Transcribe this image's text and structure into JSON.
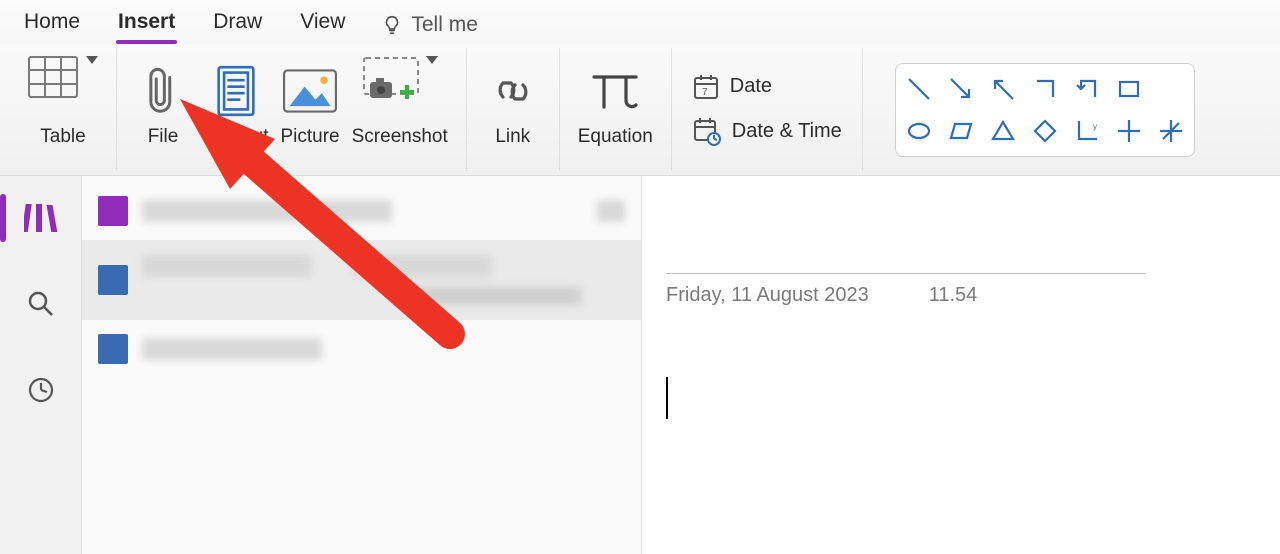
{
  "tabs": {
    "home": "Home",
    "insert": "Insert",
    "draw": "Draw",
    "view": "View",
    "tellme": "Tell me"
  },
  "ribbon": {
    "table": "Table",
    "file": "File",
    "printout": "Printout",
    "picture": "Picture",
    "screenshot": "Screenshot",
    "link": "Link",
    "equation": "Equation",
    "date": "Date",
    "datetime": "Date & Time"
  },
  "page": {
    "date_text": "Friday, 11 August 2023",
    "time_text": "11.54"
  },
  "colors": {
    "accent": "#8f2db8",
    "arrow": "#ed3424",
    "shape_stroke": "#2f6db5"
  }
}
